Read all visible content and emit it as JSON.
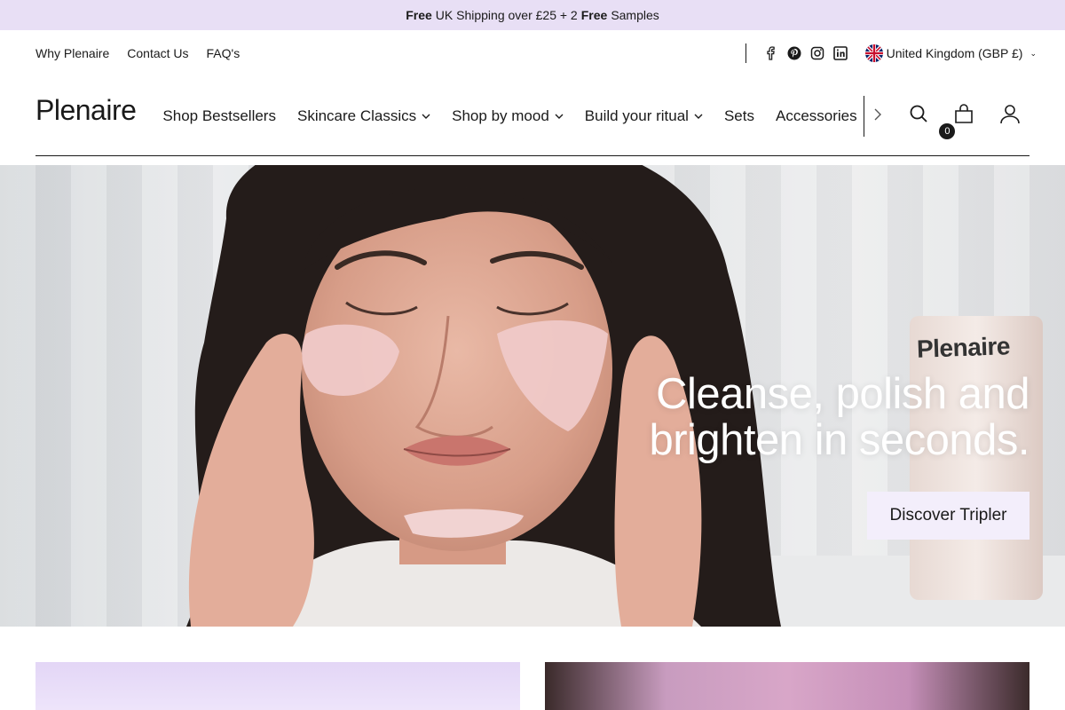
{
  "announcement": {
    "part1_bold": "Free",
    "part2": "UK Shipping over £25 + 2",
    "part3_bold": "Free",
    "part4": "Samples"
  },
  "utility": {
    "links": [
      "Why Plenaire",
      "Contact Us",
      "FAQ's"
    ],
    "social_icons": [
      "facebook-icon",
      "pinterest-icon",
      "instagram-icon",
      "linkedin-icon"
    ],
    "locale": "United Kingdom (GBP £)"
  },
  "header": {
    "logo": "Plenaire",
    "nav": [
      {
        "label": "Shop Bestsellers",
        "has_dropdown": false
      },
      {
        "label": "Skincare Classics",
        "has_dropdown": true
      },
      {
        "label": "Shop by mood",
        "has_dropdown": true
      },
      {
        "label": "Build your ritual",
        "has_dropdown": true
      },
      {
        "label": "Sets",
        "has_dropdown": false
      },
      {
        "label": "Accessories",
        "has_dropdown": false
      }
    ],
    "cart_count": "0",
    "icons": [
      "search-icon",
      "cart-icon",
      "account-icon"
    ]
  },
  "hero": {
    "headline_line1": "Cleanse, polish and",
    "headline_line2": "brighten in seconds.",
    "cta": "Discover Tripler",
    "bottle_brand": "Plenaire"
  },
  "colors": {
    "announcement_bg": "#e8dff5",
    "cta_bg": "#f3eefb",
    "text": "#1a1a1a"
  }
}
